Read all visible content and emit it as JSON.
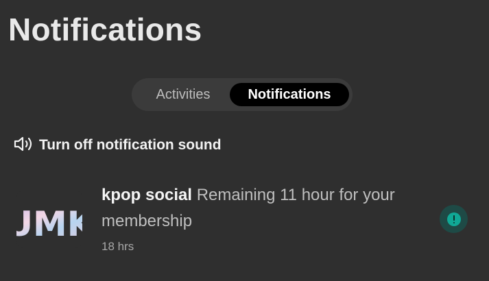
{
  "header": {
    "title": "Notifications"
  },
  "tabs": [
    {
      "label": "Activities",
      "active": false
    },
    {
      "label": "Notifications",
      "active": true
    }
  ],
  "sound_toggle": {
    "label": "Turn off notification sound",
    "icon": "speaker-icon"
  },
  "notifications": [
    {
      "sender": "kpop social",
      "message": "Remaining 11 hour for your membership",
      "time": "18 hrs",
      "avatar_text": "UMK",
      "status_icon": "alert-icon"
    }
  ],
  "colors": {
    "background": "#2f2f2f",
    "tab_track": "#3b3b3b",
    "active_tab": "#000000",
    "status_accent": "#10a896"
  }
}
